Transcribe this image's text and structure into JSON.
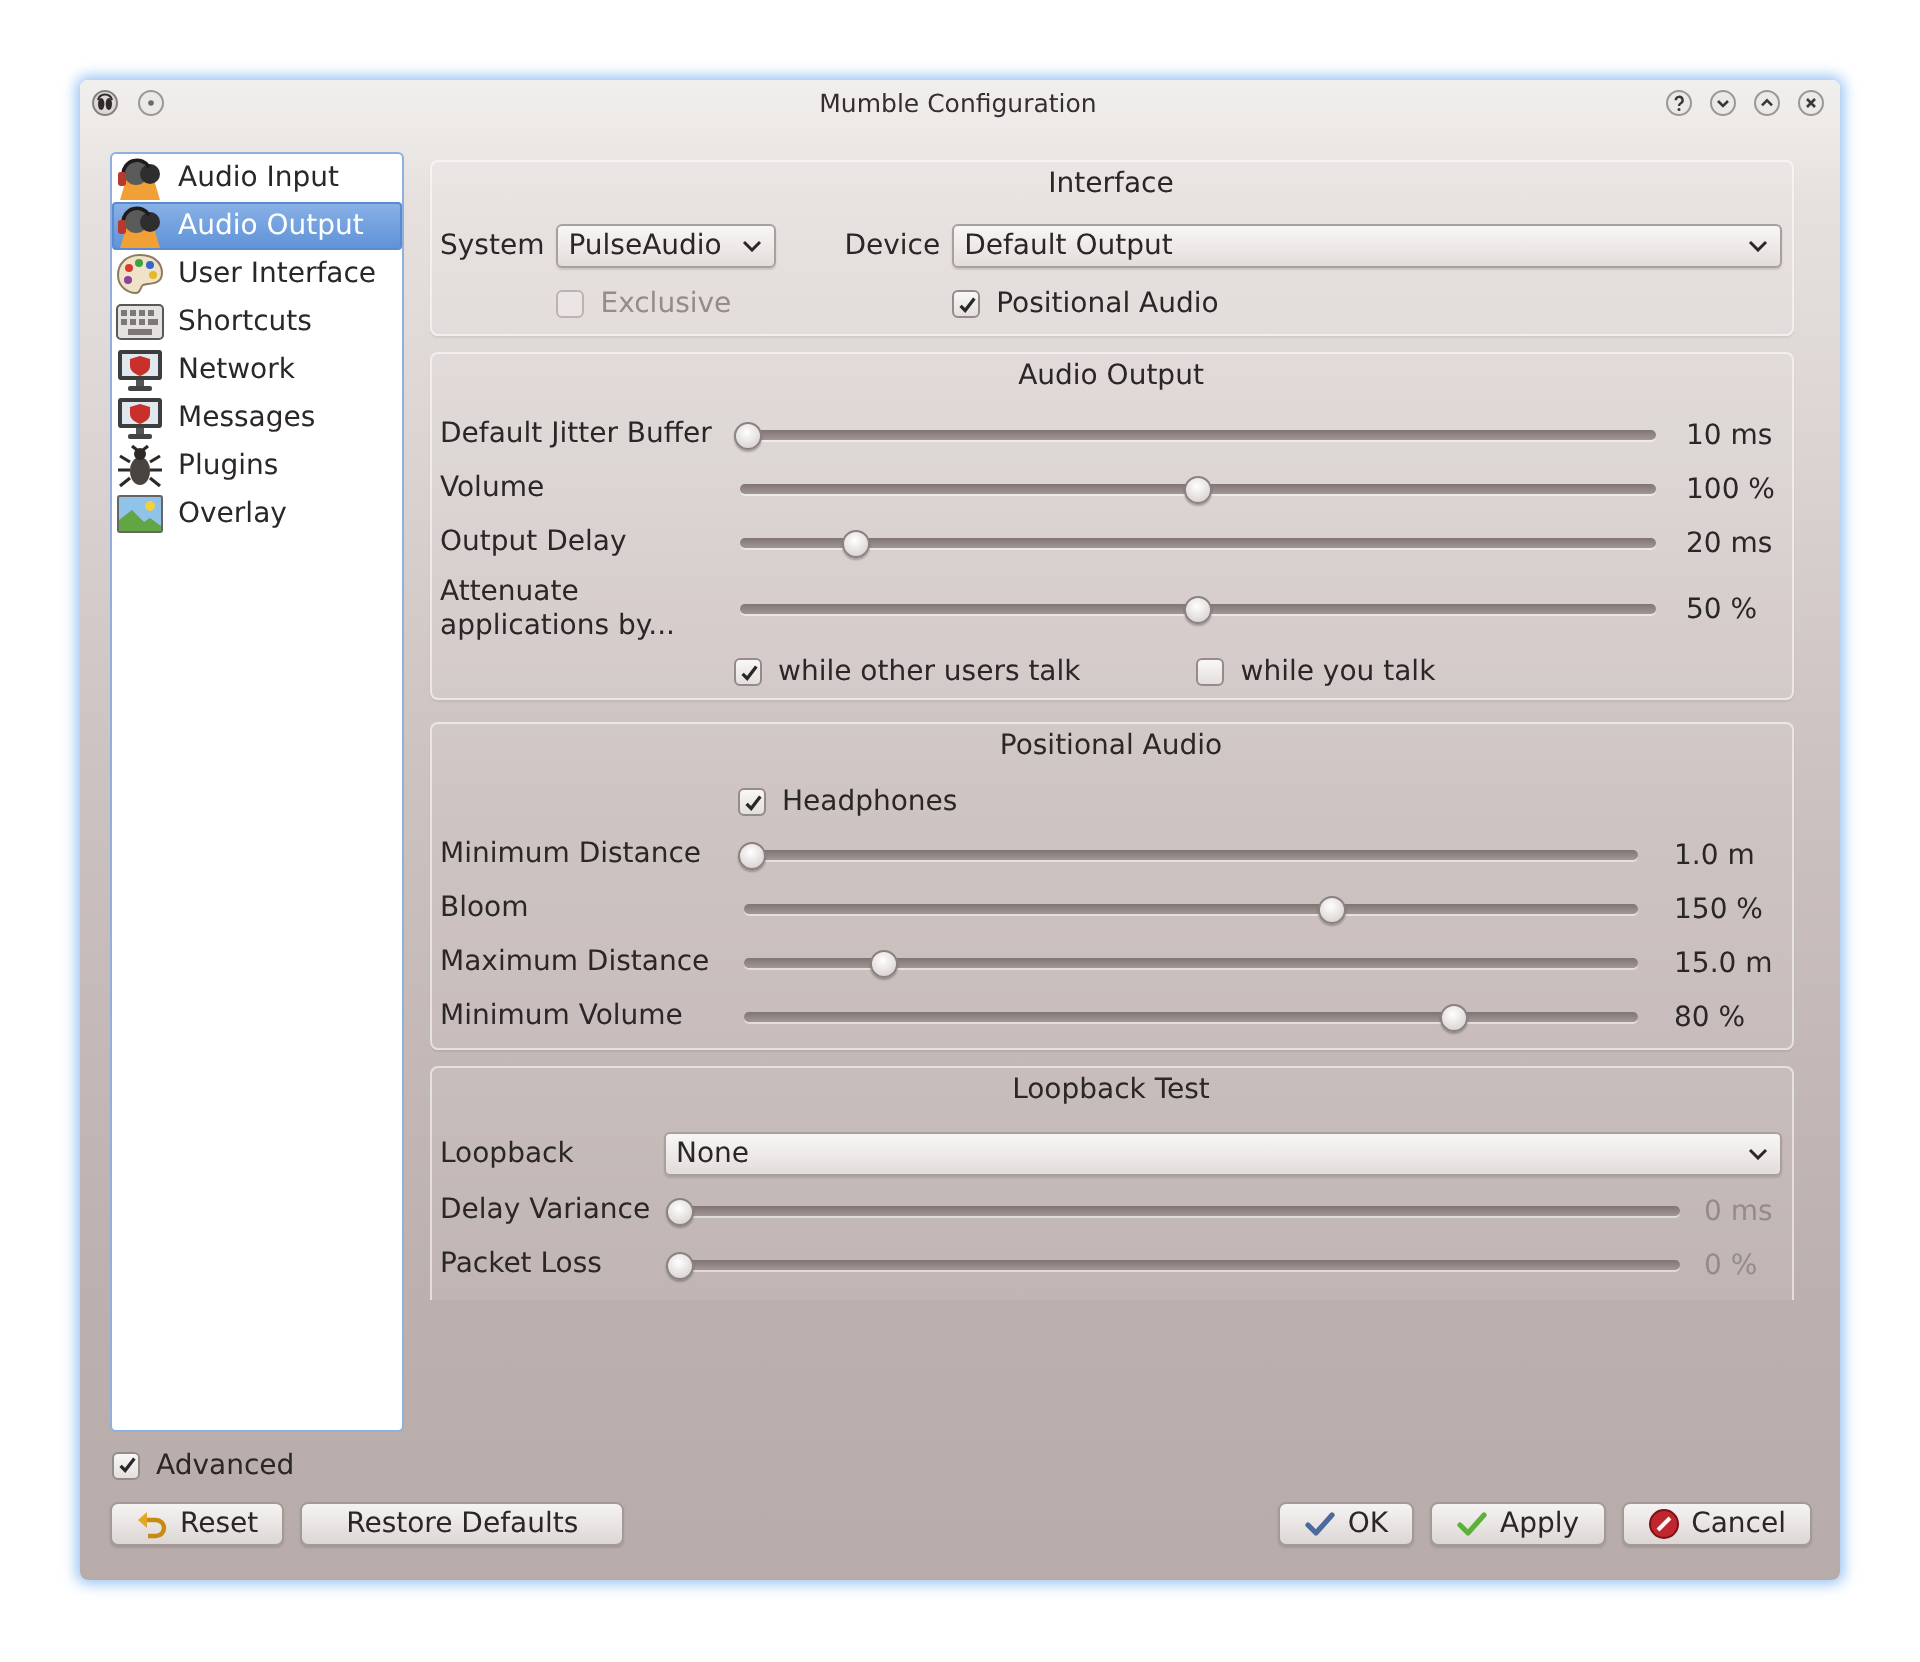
{
  "window": {
    "title": "Mumble Configuration"
  },
  "sidebar": {
    "items": [
      {
        "label": "Audio Input",
        "kind": "audio",
        "selected": false
      },
      {
        "label": "Audio Output",
        "kind": "audio",
        "selected": true
      },
      {
        "label": "User Interface",
        "kind": "interface",
        "selected": false
      },
      {
        "label": "Shortcuts",
        "kind": "shortcuts",
        "selected": false
      },
      {
        "label": "Network",
        "kind": "network",
        "selected": false
      },
      {
        "label": "Messages",
        "kind": "messages",
        "selected": false
      },
      {
        "label": "Plugins",
        "kind": "plugins",
        "selected": false
      },
      {
        "label": "Overlay",
        "kind": "overlay",
        "selected": false
      }
    ]
  },
  "interface": {
    "title": "Interface",
    "system": {
      "label": "System",
      "value": "PulseAudio"
    },
    "device": {
      "label": "Device",
      "value": "Default Output"
    },
    "exclusive": {
      "label": "Exclusive",
      "checked": false,
      "disabled": true
    },
    "positional_audio": {
      "label": "Positional Audio",
      "checked": true,
      "disabled": false
    }
  },
  "audio_output": {
    "title": "Audio Output",
    "sliders": [
      {
        "label": "Default Jitter Buffer",
        "level": 0,
        "reading": "10 ms"
      },
      {
        "label": "Volume",
        "level": 0.5,
        "reading": "100 %"
      },
      {
        "label": "Output Delay",
        "level": 0.12,
        "reading": "20 ms"
      },
      {
        "label": "Attenuate applications by...",
        "level": 0.5,
        "reading": "50 %"
      }
    ],
    "attenuate_options": [
      {
        "label": "while other users talk",
        "checked": true
      },
      {
        "label": "while you talk",
        "checked": false
      }
    ]
  },
  "positional_audio": {
    "title": "Positional Audio",
    "headphones": {
      "label": "Headphones",
      "checked": true
    },
    "sliders": [
      {
        "label": "Minimum Distance",
        "level": 0,
        "reading": "1.0 m"
      },
      {
        "label": "Bloom",
        "level": 0.66,
        "reading": "150 %"
      },
      {
        "label": "Maximum Distance",
        "level": 0.15,
        "reading": "15.0 m"
      },
      {
        "label": "Minimum Volume",
        "level": 0.8,
        "reading": "80 %"
      }
    ]
  },
  "loopback_test": {
    "title": "Loopback Test",
    "loopback": {
      "label": "Loopback",
      "value": "None"
    },
    "sliders": [
      {
        "label": "Delay Variance",
        "level": 0,
        "reading": "0 ms",
        "disabled": true
      },
      {
        "label": "Packet Loss",
        "level": 0,
        "reading": "0 %",
        "disabled": true
      }
    ]
  },
  "advanced": {
    "label": "Advanced",
    "checked": true
  },
  "buttons": {
    "left": [
      {
        "label": "Reset",
        "kind": "reset"
      },
      {
        "label": "Restore Defaults",
        "kind": "restore"
      }
    ],
    "right": [
      {
        "label": "OK",
        "kind": "ok"
      },
      {
        "label": "Apply",
        "kind": "apply"
      },
      {
        "label": "Cancel",
        "kind": "cancel"
      }
    ]
  }
}
